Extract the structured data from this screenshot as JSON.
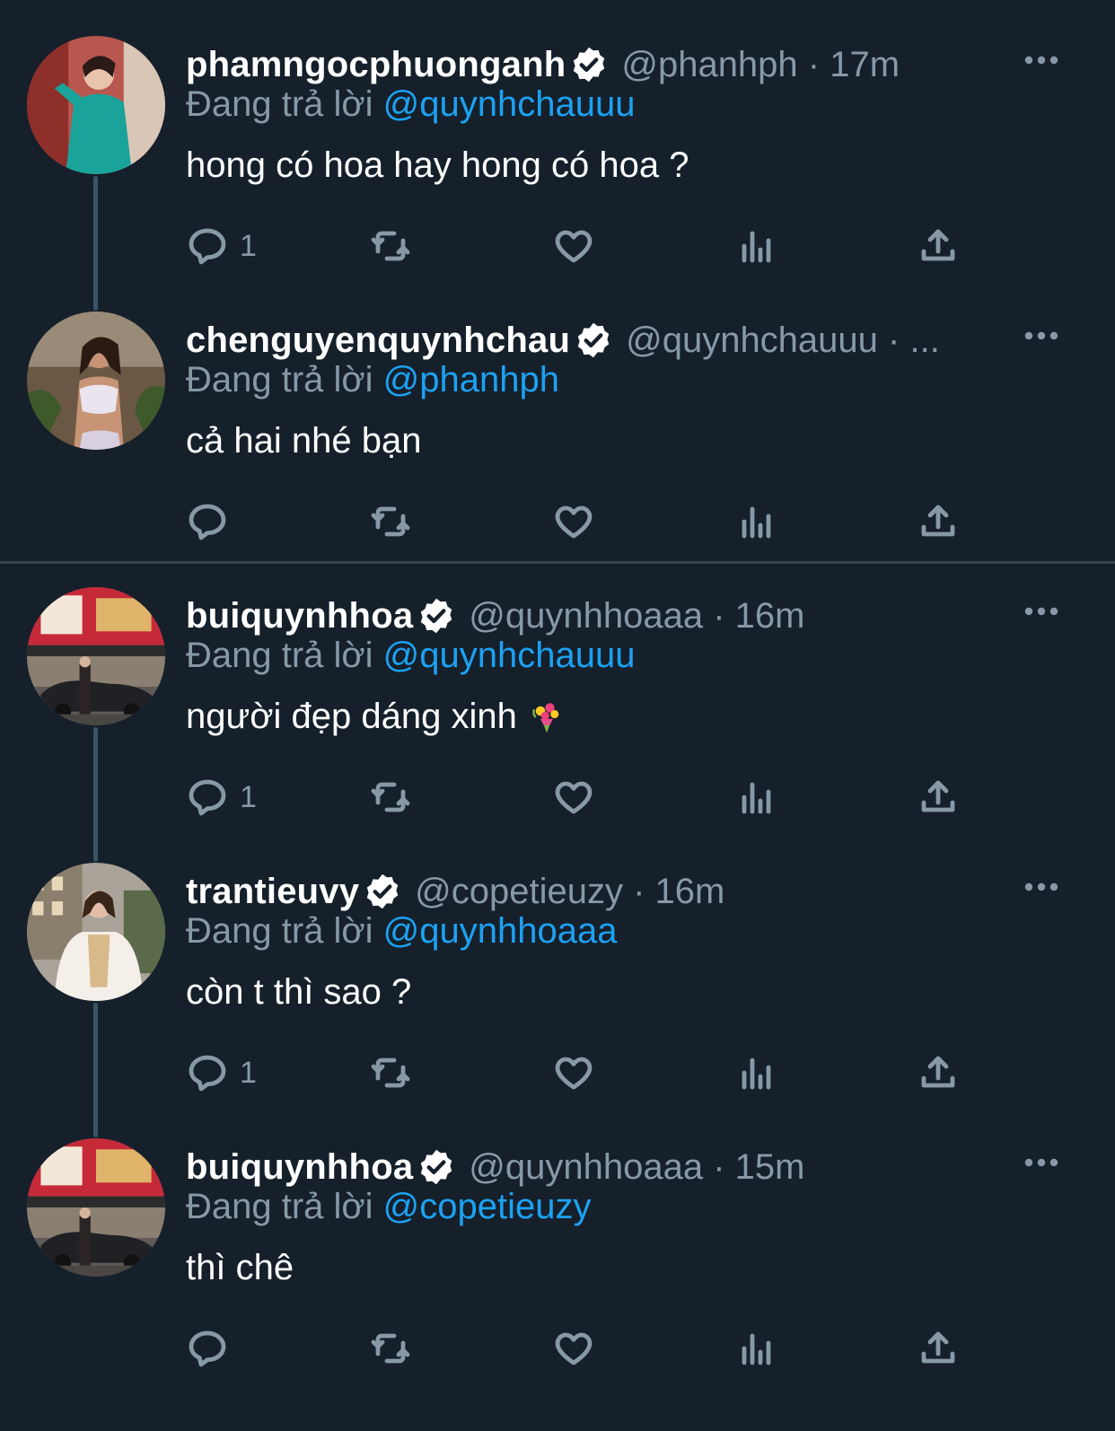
{
  "colors": {
    "background": "#15202b",
    "secondary_text": "#8899a6",
    "mention": "#1da1f2",
    "divider": "#38444d"
  },
  "tweets": [
    {
      "name": "phamngocphuonganh",
      "handle_time": "@phanhph · 17m",
      "replying_label": "Đang trả lời",
      "replying_to": "@quynhchauuu",
      "text": "hong có hoa hay hong có hoa ?",
      "reply_count": "1",
      "avatar_icon": "avatar-woman-teal-dress"
    },
    {
      "name": "chenguyenquynhchau",
      "handle_time": "@quynhchauuu · ...",
      "replying_label": "Đang trả lời",
      "replying_to": "@phanhph",
      "text": "cả hai nhé bạn",
      "reply_count": "",
      "avatar_icon": "avatar-woman-sports-top"
    },
    {
      "name": "buiquynhhoa",
      "handle_time": "@quynhhoaaa · 16m",
      "replying_label": "Đang trả lời",
      "replying_to": "@quynhchauuu",
      "text": "người đẹp dáng xinh",
      "emoji": "bouquet-emoji",
      "reply_count": "1",
      "avatar_icon": "avatar-street-ramen-shop"
    },
    {
      "name": "trantieuvy",
      "handle_time": "@copetieuzy · 16m",
      "replying_label": "Đang trả lời",
      "replying_to": "@quynhhoaaa",
      "text": "còn t thì sao ?",
      "reply_count": "1",
      "avatar_icon": "avatar-woman-fur-coat"
    },
    {
      "name": "buiquynhhoa",
      "handle_time": "@quynhhoaaa · 15m",
      "replying_label": "Đang trả lời",
      "replying_to": "@copetieuzy",
      "text": "thì chê",
      "reply_count": "",
      "avatar_icon": "avatar-street-ramen-shop"
    }
  ]
}
